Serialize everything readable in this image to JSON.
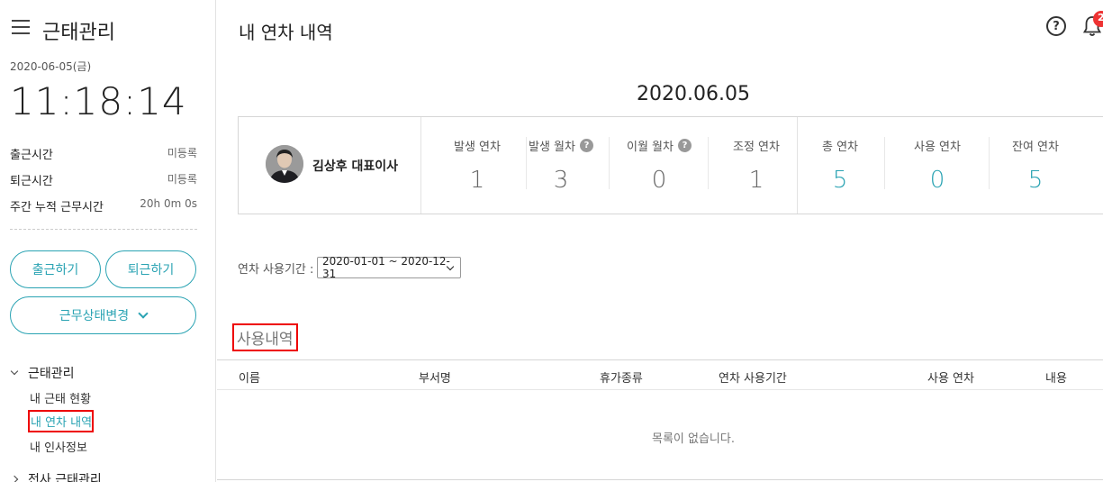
{
  "sidebar": {
    "app_title": "근태관리",
    "date": "2020-06-05(금)",
    "clock": "11:18:14",
    "info": [
      {
        "label": "출근시간",
        "value": "미등록"
      },
      {
        "label": "퇴근시간",
        "value": "미등록"
      },
      {
        "label": "주간 누적 근무시간",
        "value": "20h 0m 0s"
      }
    ],
    "buttons": {
      "clock_in": "출근하기",
      "clock_out": "퇴근하기",
      "status_change": "근무상태변경"
    },
    "nav": {
      "group1": "근태관리",
      "items": [
        "내 근태 현황",
        "내 연차 내역",
        "내 인사정보"
      ],
      "group2": "전사 근태관리"
    }
  },
  "header": {
    "title": "내 연차 내역",
    "help": "?",
    "notification_count": "2"
  },
  "summary": {
    "date": "2020.06.05",
    "name": "김상후 대표이사",
    "stats": [
      {
        "label": "발생 연차",
        "value": "1",
        "help": false
      },
      {
        "label": "발생 월차",
        "value": "3",
        "help": true
      },
      {
        "label": "이월 월차",
        "value": "0",
        "help": true
      },
      {
        "label": "조정 연차",
        "value": "1",
        "help": false
      },
      {
        "label": "총 연차",
        "value": "5",
        "help": false
      },
      {
        "label": "사용 연차",
        "value": "0",
        "help": false
      },
      {
        "label": "잔여 연차",
        "value": "5",
        "help": false
      }
    ]
  },
  "filter": {
    "label": "연차 사용기간 :",
    "selected": "2020-01-01 ~ 2020-12-31"
  },
  "usage": {
    "title": "사용내역",
    "columns": [
      "이름",
      "부서명",
      "휴가종류",
      "연차 사용기간",
      "사용 연차",
      "내용"
    ],
    "empty_text": "목록이 없습니다."
  },
  "colors": {
    "accent": "#2aa3b3",
    "highlight": "#ee0000",
    "badge": "#ee3333"
  }
}
